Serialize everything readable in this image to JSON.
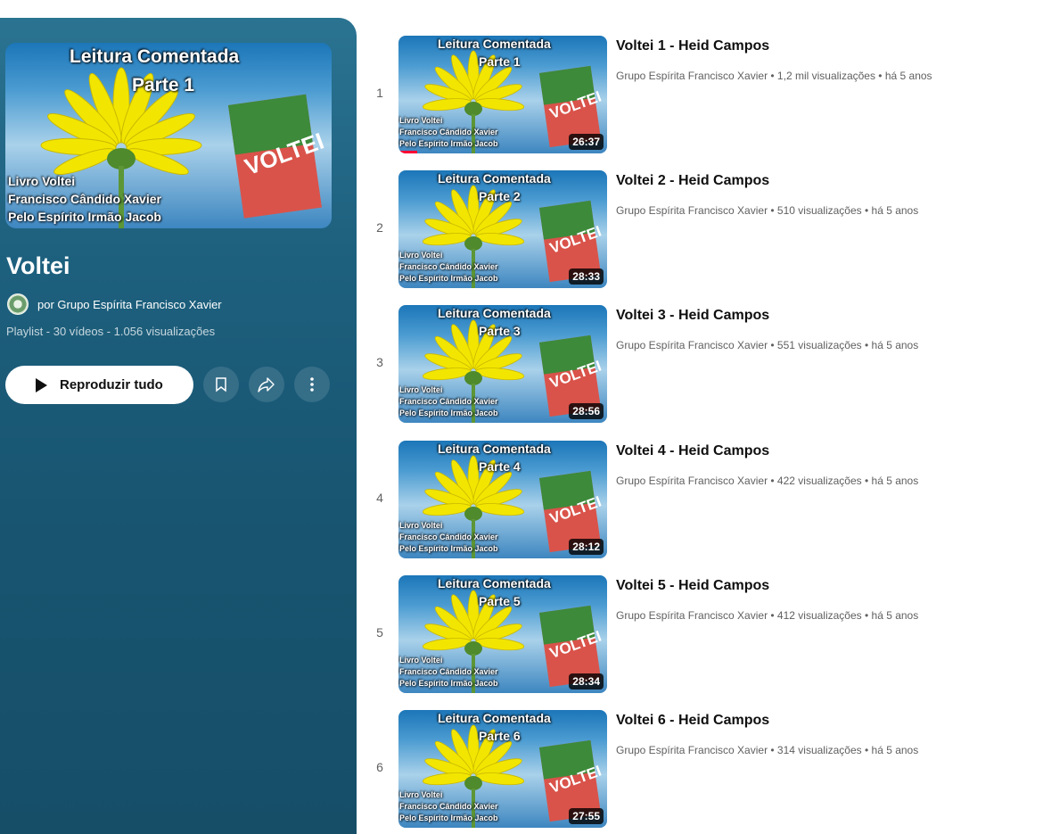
{
  "playlist": {
    "title": "Voltei",
    "owner_text": "por Grupo Espírita Francisco Xavier",
    "stats": "Playlist - 30 vídeos - 1.056 visualizações",
    "play_all_label": "Reproduzir tudo",
    "hero": {
      "line1": "Leitura Comentada",
      "line2": "Parte 1",
      "caption": [
        "Livro Voltei",
        "Francisco Cândido Xavier",
        "Pelo Espírito Irmão Jacob"
      ],
      "book": "VOLTEI"
    },
    "icons": [
      "bookmark-icon",
      "share-icon",
      "more-vert-icon",
      "play-icon"
    ]
  },
  "videos": [
    {
      "index": "1",
      "title": "Voltei 1 - Heid Campos",
      "meta": "Grupo Espírita Francisco Xavier • 1,2 mil visualizações • há 5 anos",
      "duration": "26:37",
      "thumb_line1": "Leitura Comentada",
      "thumb_line2": "Parte 1",
      "watched_fraction": 0.09
    },
    {
      "index": "2",
      "title": "Voltei 2 - Heid Campos",
      "meta": "Grupo Espírita Francisco Xavier • 510 visualizações • há 5 anos",
      "duration": "28:33",
      "thumb_line1": "Leitura Comentada",
      "thumb_line2": "Parte 2"
    },
    {
      "index": "3",
      "title": "Voltei 3 - Heid Campos",
      "meta": "Grupo Espírita Francisco Xavier • 551 visualizações • há 5 anos",
      "duration": "28:56",
      "thumb_line1": "Leitura Comentada",
      "thumb_line2": "Parte 3"
    },
    {
      "index": "4",
      "title": "Voltei 4 - Heid Campos",
      "meta": "Grupo Espírita Francisco Xavier • 422 visualizações • há 5 anos",
      "duration": "28:12",
      "thumb_line1": "Leitura Comentada",
      "thumb_line2": "Parte 4"
    },
    {
      "index": "5",
      "title": "Voltei 5 - Heid Campos",
      "meta": "Grupo Espírita Francisco Xavier • 412 visualizações • há 5 anos",
      "duration": "28:34",
      "thumb_line1": "Leitura Comentada",
      "thumb_line2": "Parte 5"
    },
    {
      "index": "6",
      "title": "Voltei 6 - Heid Campos",
      "meta": "Grupo Espírita Francisco Xavier • 314 visualizações • há 5 anos",
      "duration": "27:55",
      "thumb_line1": "Leitura Comentada",
      "thumb_line2": "Parte 6"
    }
  ],
  "colors": {
    "panel": "#1d607e",
    "progress": "#ff0033",
    "title_text": "#0f0f0f",
    "meta_text": "#606060"
  }
}
